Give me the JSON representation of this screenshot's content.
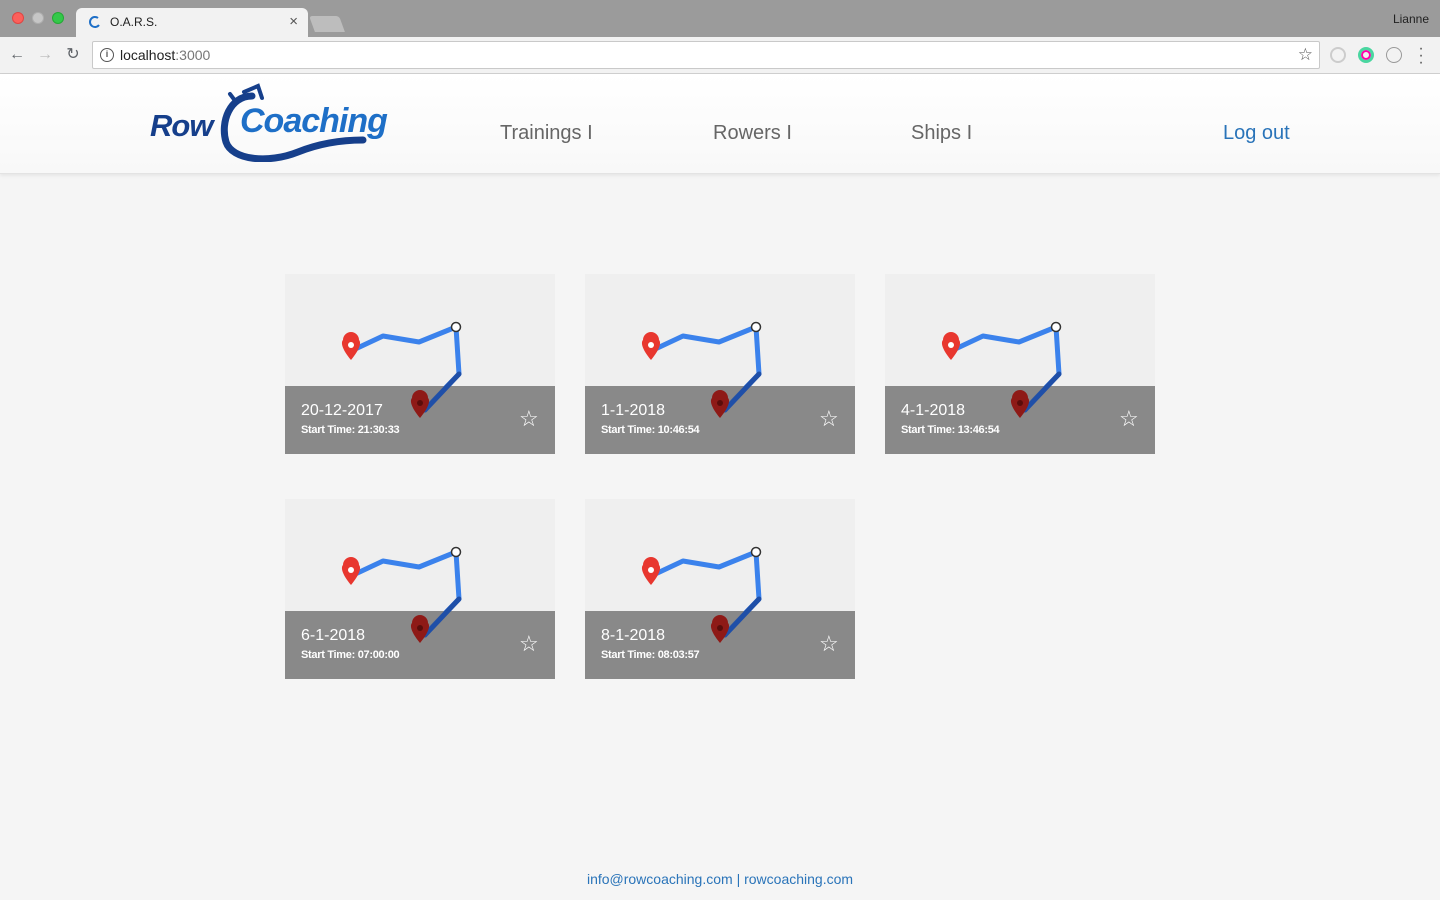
{
  "browser": {
    "tab_title": "O.A.R.S.",
    "tab_close": "×",
    "profile_name": "Lianne",
    "url_host": "localhost",
    "url_port": ":3000"
  },
  "logo": {
    "word1": "Row",
    "word2": "Coaching"
  },
  "nav": {
    "trainings": "Trainings I",
    "rowers": "Rowers I",
    "ships": "Ships I",
    "logout": "Log out"
  },
  "trainings": [
    {
      "date": "20-12-2017",
      "start_time": "Start Time: 21:30:33",
      "favorite": "☆"
    },
    {
      "date": "1-1-2018",
      "start_time": "Start Time: 10:46:54",
      "favorite": "☆"
    },
    {
      "date": "4-1-2018",
      "start_time": "Start Time: 13:46:54",
      "favorite": "☆"
    },
    {
      "date": "6-1-2018",
      "start_time": "Start Time: 07:00:00",
      "favorite": "☆"
    },
    {
      "date": "8-1-2018",
      "start_time": "Start Time: 08:03:57",
      "favorite": "☆"
    }
  ],
  "footer": {
    "email": "info@rowcoaching.com",
    "separator": "|",
    "website": "rowcoaching.com"
  },
  "colors": {
    "route": "#3b82ec",
    "route_dark": "#1f4fa8",
    "start_pin": "#e8372f",
    "end_pin": "#8e1a17",
    "brand_dark": "#163f8b",
    "brand_light": "#1e6fc7",
    "link": "#2a74b9"
  }
}
